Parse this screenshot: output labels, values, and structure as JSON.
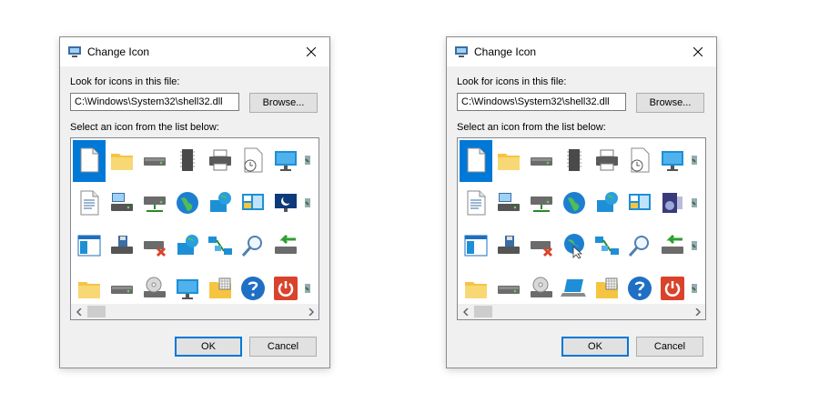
{
  "dialogs": [
    {
      "title": "Change Icon",
      "look_label": "Look for icons in this file:",
      "path_value": "C:\\Windows\\System32\\shell32.dll",
      "browse_label": "Browse...",
      "select_label": "Select an icon from the list below:",
      "ok_label": "OK",
      "cancel_label": "Cancel",
      "icons": [
        [
          "blank-document-icon",
          "folder-icon",
          "drive-icon",
          "memory-chip-icon",
          "printer-icon",
          "document-clock-icon",
          "monitor-icon",
          "partial-icon"
        ],
        [
          "text-document-icon",
          "computer-drive-icon",
          "network-drive-icon",
          "globe-icon",
          "network-globe-icon",
          "control-panel-icon",
          "screen-sleep-icon",
          "partial-icon"
        ],
        [
          "window-icon",
          "floppy-drive-icon",
          "drive-error-icon",
          "network-globe-icon",
          "network-icon",
          "search-icon",
          "move-drive-icon",
          "blank"
        ],
        [
          "folder-icon",
          "drive-icon",
          "optical-drive-icon",
          "monitor-icon",
          "folder-grid-icon",
          "help-icon",
          "power-icon",
          "partial-icon"
        ]
      ],
      "selected_icon": "blank-document-icon"
    },
    {
      "title": "Change Icon",
      "look_label": "Look for icons in this file:",
      "path_value": "C:\\Windows\\System32\\shell32.dll",
      "browse_label": "Browse...",
      "select_label": "Select an icon from the list below:",
      "ok_label": "OK",
      "cancel_label": "Cancel",
      "icons": [
        [
          "blank-document-icon",
          "folder-icon",
          "drive-icon",
          "memory-chip-icon",
          "printer-icon",
          "document-clock-icon",
          "monitor-icon",
          "partial-icon"
        ],
        [
          "text-document-icon",
          "computer-drive-icon",
          "network-drive-icon",
          "globe-icon",
          "network-globe-icon",
          "control-panel-icon",
          "speaker-icon",
          "partial-icon"
        ],
        [
          "window-icon",
          "floppy-drive-icon",
          "drive-error-icon",
          "globe-cursor-icon",
          "network-icon",
          "search-icon",
          "move-drive-icon",
          "partial-icon"
        ],
        [
          "folder-icon",
          "drive-icon",
          "optical-drive-icon",
          "laptop-icon",
          "folder-grid-icon",
          "help-icon",
          "power-icon",
          "partial-icon"
        ]
      ],
      "selected_icon": "blank-document-icon"
    }
  ],
  "colors": {
    "accent": "#0078d7",
    "dialog_bg": "#f0f0f0",
    "help_blue": "#1f6fc5",
    "power_red": "#d9432c",
    "folder_yellow": "#f5c542"
  }
}
